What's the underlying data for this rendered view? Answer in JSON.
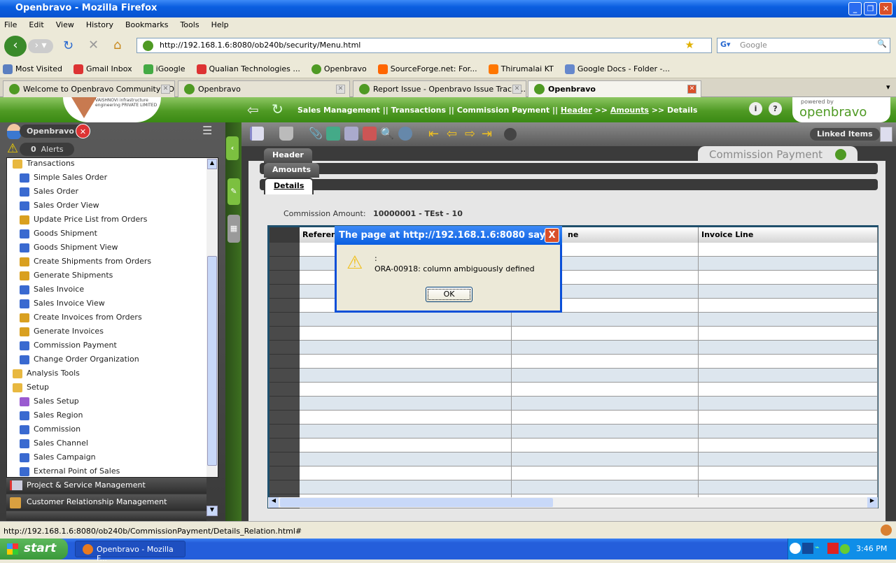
{
  "window": {
    "title": "Openbravo - Mozilla Firefox"
  },
  "menu": [
    "File",
    "Edit",
    "View",
    "History",
    "Bookmarks",
    "Tools",
    "Help"
  ],
  "nav": {
    "url": "http://192.168.1.6:8080/ob240b/security/Menu.html",
    "search_placeholder": "Google"
  },
  "bookmarks": [
    "Most Visited",
    "Gmail Inbox",
    "iGoogle",
    "Qualian Technologies ...",
    "Openbravo",
    "SourceForge.net: For...",
    "Thirumalai KT",
    "Google Docs - Folder -..."
  ],
  "browser_tabs": [
    {
      "label": "Welcome to Openbravo Community - O...",
      "active": false
    },
    {
      "label": "Openbravo",
      "active": false
    },
    {
      "label": "Report Issue - Openbravo Issue Tracki...",
      "active": false
    },
    {
      "label": "Openbravo",
      "active": true
    }
  ],
  "app": {
    "logo_text": "VAISHNOVI infrastructure engineering PRIVATE LIMITED",
    "breadcrumb": {
      "part1": "Sales Management || Transactions || Commission Payment ||",
      "header": "Header",
      "sep1": ">>",
      "amounts": "Amounts",
      "sep2": ">>",
      "details": "Details"
    },
    "powered_by": "powered by",
    "brand": "openbravo",
    "user": "Openbravo",
    "alerts_count": "0",
    "alerts_label": "Alerts",
    "tree": [
      {
        "label": "Transactions",
        "type": "folder",
        "indent": 0
      },
      {
        "label": "Simple Sales Order",
        "type": "window",
        "indent": 1
      },
      {
        "label": "Sales Order",
        "type": "window",
        "indent": 1
      },
      {
        "label": "Sales Order View",
        "type": "window",
        "indent": 1
      },
      {
        "label": "Update Price List from Orders",
        "type": "process",
        "indent": 1
      },
      {
        "label": "Goods Shipment",
        "type": "window",
        "indent": 1
      },
      {
        "label": "Goods Shipment View",
        "type": "window",
        "indent": 1
      },
      {
        "label": "Create Shipments from Orders",
        "type": "process",
        "indent": 1
      },
      {
        "label": "Generate Shipments",
        "type": "process",
        "indent": 1
      },
      {
        "label": "Sales Invoice",
        "type": "window",
        "indent": 1
      },
      {
        "label": "Sales Invoice View",
        "type": "window",
        "indent": 1
      },
      {
        "label": "Create Invoices from Orders",
        "type": "process",
        "indent": 1
      },
      {
        "label": "Generate Invoices",
        "type": "process",
        "indent": 1
      },
      {
        "label": "Commission Payment",
        "type": "window",
        "indent": 1
      },
      {
        "label": "Change Order Organization",
        "type": "window",
        "indent": 1
      },
      {
        "label": "Analysis Tools",
        "type": "folder",
        "indent": 0
      },
      {
        "label": "Setup",
        "type": "folder",
        "indent": 0
      },
      {
        "label": "Sales Setup",
        "type": "setup",
        "indent": 1
      },
      {
        "label": "Sales Region",
        "type": "window",
        "indent": 1
      },
      {
        "label": "Commission",
        "type": "window",
        "indent": 1
      },
      {
        "label": "Sales Channel",
        "type": "window",
        "indent": 1
      },
      {
        "label": "Sales Campaign",
        "type": "window",
        "indent": 1
      },
      {
        "label": "External Point of Sales",
        "type": "window",
        "indent": 1
      }
    ],
    "modules": [
      "Project & Service Management",
      "Customer Relationship Management"
    ],
    "linked_items": "Linked Items",
    "window_title": "Commission Payment",
    "form_tabs": [
      "Header",
      "Amounts",
      "Details"
    ],
    "field_label": "Commission Amount:",
    "field_value": "10000001 - TEst - 10",
    "columns": [
      "Reference",
      "ne",
      "Invoice Line"
    ],
    "row_count": 19
  },
  "dialog": {
    "title": "The page at http://192.168.1.6:8080 says:",
    "line1": ":",
    "message": "ORA-00918: column ambiguously defined",
    "ok": "OK",
    "close": "X"
  },
  "status": {
    "text": "http://192.168.1.6:8080/ob240b/CommissionPayment/Details_Relation.html#"
  },
  "taskbar": {
    "start": "start",
    "task": "Openbravo - Mozilla F...",
    "clock": "3:46 PM"
  },
  "colors": {
    "green": "#4f9a24",
    "xp_blue": "#0a5ee0"
  }
}
